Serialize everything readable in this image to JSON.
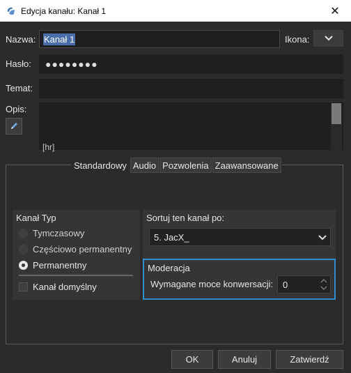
{
  "window": {
    "title": "Edycja kanału: Kanał 1",
    "close_glyph": "✕"
  },
  "form": {
    "name_label": "Nazwa:",
    "name_value": "Kanał 1",
    "icon_label": "Ikona:",
    "password_label": "Hasło:",
    "password_mask": "●●●●●●●●",
    "topic_label": "Temat:",
    "topic_value": "",
    "description_label": "Opis:",
    "description_value": "[hr]"
  },
  "tabs": [
    {
      "label": "Standardowy",
      "active": true
    },
    {
      "label": "Audio",
      "active": false
    },
    {
      "label": "Pozwolenia",
      "active": false
    },
    {
      "label": "Zaawansowane",
      "active": false
    }
  ],
  "channel_type": {
    "title": "Kanał Typ",
    "options": [
      {
        "label": "Tymczasowy",
        "selected": false
      },
      {
        "label": "Częściowo permanentny",
        "selected": false
      },
      {
        "label": "Permanentny",
        "selected": true
      }
    ],
    "default_channel_label": "Kanał domyślny",
    "default_channel_checked": false
  },
  "sort": {
    "label": "Sortuj ten kanał po:",
    "selected": "5. JacX_"
  },
  "moderation": {
    "title": "Moderacja",
    "talk_power_label": "Wymagane moce konwersacji:",
    "talk_power_value": "0",
    "highlight_color": "#2f8fce"
  },
  "buttons": {
    "ok": "OK",
    "cancel": "Anuluj",
    "apply": "Zatwierdź"
  },
  "icons": {
    "app": "teamspeak-logo-icon",
    "edit": "pencil-icon",
    "dropdown": "chevron-down-icon",
    "spinner": "spinner-arrows-icon"
  }
}
